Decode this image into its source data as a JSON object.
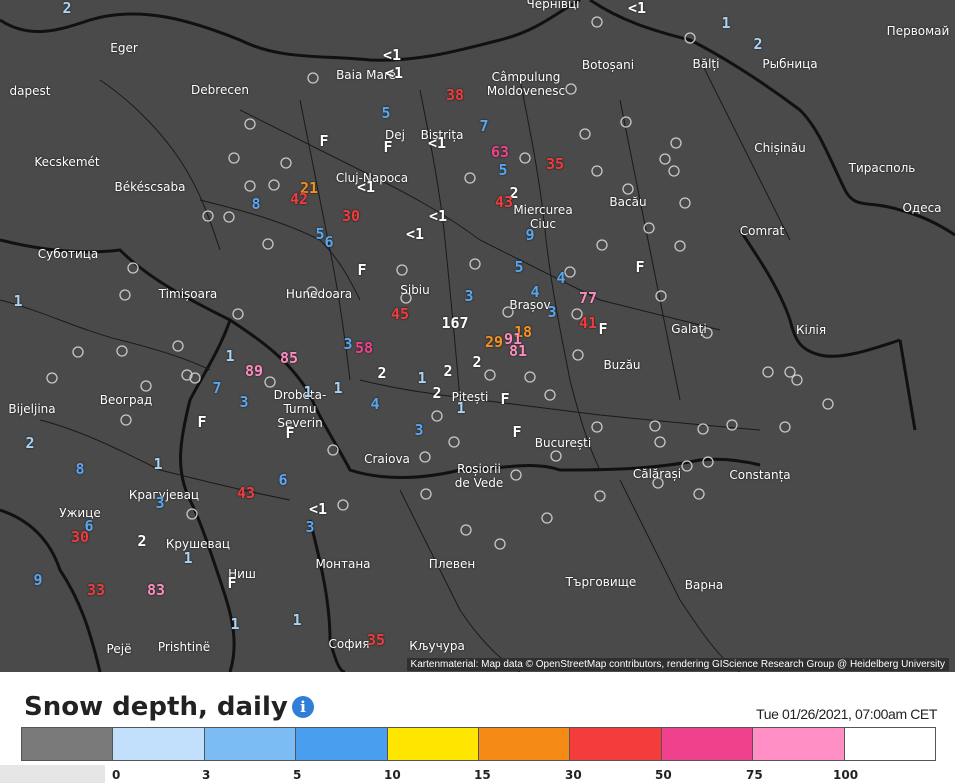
{
  "map": {
    "attribution": "Kartenmaterial: Map data © OpenStreetMap contributors, rendering GIScience Research Group @ Heidelberg University",
    "cities": [
      {
        "label": "Чернівці"
      },
      {
        "label": "Первомай"
      },
      {
        "label": "Eger"
      },
      {
        "label": "Baia Mare"
      },
      {
        "label": "Botoșani"
      },
      {
        "label": "Bălți"
      },
      {
        "label": "Рыбница"
      },
      {
        "label": "dapest"
      },
      {
        "label": "Debrecen"
      },
      {
        "label": "Câmpulung Moldovenesc"
      },
      {
        "label": "Dej"
      },
      {
        "label": "Bistrița"
      },
      {
        "label": "Chișinău"
      },
      {
        "label": "Kecskemét"
      },
      {
        "label": "Тирасполь"
      },
      {
        "label": "Cluj-Napoca"
      },
      {
        "label": "Békéscsaba"
      },
      {
        "label": "Bacău"
      },
      {
        "label": "Одеса"
      },
      {
        "label": "Miercurea Ciuc"
      },
      {
        "label": "Comrat"
      },
      {
        "label": "Суботица"
      },
      {
        "label": "Timișoara"
      },
      {
        "label": "Hunedoara"
      },
      {
        "label": "Sibiu"
      },
      {
        "label": "Brașov"
      },
      {
        "label": "Galați"
      },
      {
        "label": "Кілія"
      },
      {
        "label": "Buzău"
      },
      {
        "label": "Beoгрaд"
      },
      {
        "label": "Bijeljina"
      },
      {
        "label": "Drobeta-Turnu Severin"
      },
      {
        "label": "Pitești"
      },
      {
        "label": "București"
      },
      {
        "label": "Craiova"
      },
      {
        "label": "Roșiorii de Vede"
      },
      {
        "label": "Călărași"
      },
      {
        "label": "Constanța"
      },
      {
        "label": "Крагујевац"
      },
      {
        "label": "Ужице"
      },
      {
        "label": "Крушевац"
      },
      {
        "label": "Монтана"
      },
      {
        "label": "Плевен"
      },
      {
        "label": "Търговище"
      },
      {
        "label": "Варна"
      },
      {
        "label": "Ниш"
      },
      {
        "label": "Pejë"
      },
      {
        "label": "Prishtinë"
      },
      {
        "label": "София"
      },
      {
        "label": "Кључура"
      }
    ],
    "readings": [
      {
        "v": "2",
        "c": "#aad4f5"
      },
      {
        "v": "<1",
        "c": "#ffffff"
      },
      {
        "v": "1",
        "c": "#aad4f5"
      },
      {
        "v": "2",
        "c": "#aad4f5"
      },
      {
        "v": "<1",
        "c": "#ffffff"
      },
      {
        "v": "<1",
        "c": "#ffffff"
      },
      {
        "v": "38",
        "c": "#f03c3c"
      },
      {
        "v": "5",
        "c": "#5aa7f0"
      },
      {
        "v": "7",
        "c": "#5aa7f0"
      },
      {
        "v": "F",
        "c": "#ffffff"
      },
      {
        "v": "F",
        "c": "#ffffff"
      },
      {
        "v": "<1",
        "c": "#ffffff"
      },
      {
        "v": "63",
        "c": "#f0428c"
      },
      {
        "v": "35",
        "c": "#f03c3c"
      },
      {
        "v": "5",
        "c": "#5aa7f0"
      },
      {
        "v": "<1",
        "c": "#ffffff"
      },
      {
        "v": "21",
        "c": "#f5921e"
      },
      {
        "v": "42",
        "c": "#f03c3c"
      },
      {
        "v": "2",
        "c": "#ffffff"
      },
      {
        "v": "43",
        "c": "#f03c3c"
      },
      {
        "v": "8",
        "c": "#5aa7f0"
      },
      {
        "v": "30",
        "c": "#f03c3c"
      },
      {
        "v": "<1",
        "c": "#ffffff"
      },
      {
        "v": "9",
        "c": "#5aa7f0"
      },
      {
        "v": "5",
        "c": "#5aa7f0"
      },
      {
        "v": "6",
        "c": "#5aa7f0"
      },
      {
        "v": "<1",
        "c": "#ffffff"
      },
      {
        "v": "5",
        "c": "#5aa7f0"
      },
      {
        "v": "4",
        "c": "#5aa7f0"
      },
      {
        "v": "F",
        "c": "#ffffff"
      },
      {
        "v": "F",
        "c": "#ffffff"
      },
      {
        "v": "4",
        "c": "#5aa7f0"
      },
      {
        "v": "77",
        "c": "#ff8cc0"
      },
      {
        "v": "1",
        "c": "#aad4f5"
      },
      {
        "v": "3",
        "c": "#5aa7f0"
      },
      {
        "v": "3",
        "c": "#5aa7f0"
      },
      {
        "v": "45",
        "c": "#f03c3c"
      },
      {
        "v": "167",
        "c": "#ffffff"
      },
      {
        "v": "18",
        "c": "#f5921e"
      },
      {
        "v": "41",
        "c": "#f03c3c"
      },
      {
        "v": "F",
        "c": "#ffffff"
      },
      {
        "v": "3",
        "c": "#5aa7f0"
      },
      {
        "v": "58",
        "c": "#f0428c"
      },
      {
        "v": "29",
        "c": "#f5921e"
      },
      {
        "v": "91",
        "c": "#ff8cc0"
      },
      {
        "v": "81",
        "c": "#ff8cc0"
      },
      {
        "v": "1",
        "c": "#aad4f5"
      },
      {
        "v": "85",
        "c": "#ff8cc0"
      },
      {
        "v": "89",
        "c": "#ff8cc0"
      },
      {
        "v": "2",
        "c": "#ffffff"
      },
      {
        "v": "1",
        "c": "#aad4f5"
      },
      {
        "v": "2",
        "c": "#ffffff"
      },
      {
        "v": "2",
        "c": "#ffffff"
      },
      {
        "v": "7",
        "c": "#5aa7f0"
      },
      {
        "v": "1",
        "c": "#aad4f5"
      },
      {
        "v": "1",
        "c": "#aad4f5"
      },
      {
        "v": "3",
        "c": "#5aa7f0"
      },
      {
        "v": "4",
        "c": "#5aa7f0"
      },
      {
        "v": "2",
        "c": "#ffffff"
      },
      {
        "v": "1",
        "c": "#aad4f5"
      },
      {
        "v": "F",
        "c": "#ffffff"
      },
      {
        "v": "F",
        "c": "#ffffff"
      },
      {
        "v": "F",
        "c": "#ffffff"
      },
      {
        "v": "3",
        "c": "#5aa7f0"
      },
      {
        "v": "F",
        "c": "#ffffff"
      },
      {
        "v": "2",
        "c": "#aad4f5"
      },
      {
        "v": "8",
        "c": "#5aa7f0"
      },
      {
        "v": "1",
        "c": "#aad4f5"
      },
      {
        "v": "43",
        "c": "#f03c3c"
      },
      {
        "v": "6",
        "c": "#5aa7f0"
      },
      {
        "v": "3",
        "c": "#5aa7f0"
      },
      {
        "v": "<1",
        "c": "#ffffff"
      },
      {
        "v": "6",
        "c": "#5aa7f0"
      },
      {
        "v": "30",
        "c": "#f03c3c"
      },
      {
        "v": "2",
        "c": "#ffffff"
      },
      {
        "v": "3",
        "c": "#5aa7f0"
      },
      {
        "v": "1",
        "c": "#aad4f5"
      },
      {
        "v": "9",
        "c": "#5aa7f0"
      },
      {
        "v": "33",
        "c": "#f03c3c"
      },
      {
        "v": "83",
        "c": "#ff8cc0"
      },
      {
        "v": "F",
        "c": "#ffffff"
      },
      {
        "v": "1",
        "c": "#aad4f5"
      },
      {
        "v": "1",
        "c": "#aad4f5"
      },
      {
        "v": "35",
        "c": "#f03c3c"
      }
    ]
  },
  "legend": {
    "title": "Snow depth, daily",
    "info_glyph": "i",
    "timestamp": "Tue 01/26/2021, 07:00am CET",
    "colors": [
      "#7a7a7a",
      "#c2e0fb",
      "#7cbcf5",
      "#4a9ef0",
      "#ffe600",
      "#f58a14",
      "#f53c3c",
      "#f0428c",
      "#ff8fc4",
      "#ffffff"
    ],
    "ticks": [
      "0",
      "3",
      "5",
      "10",
      "15",
      "30",
      "50",
      "75",
      "100"
    ]
  }
}
